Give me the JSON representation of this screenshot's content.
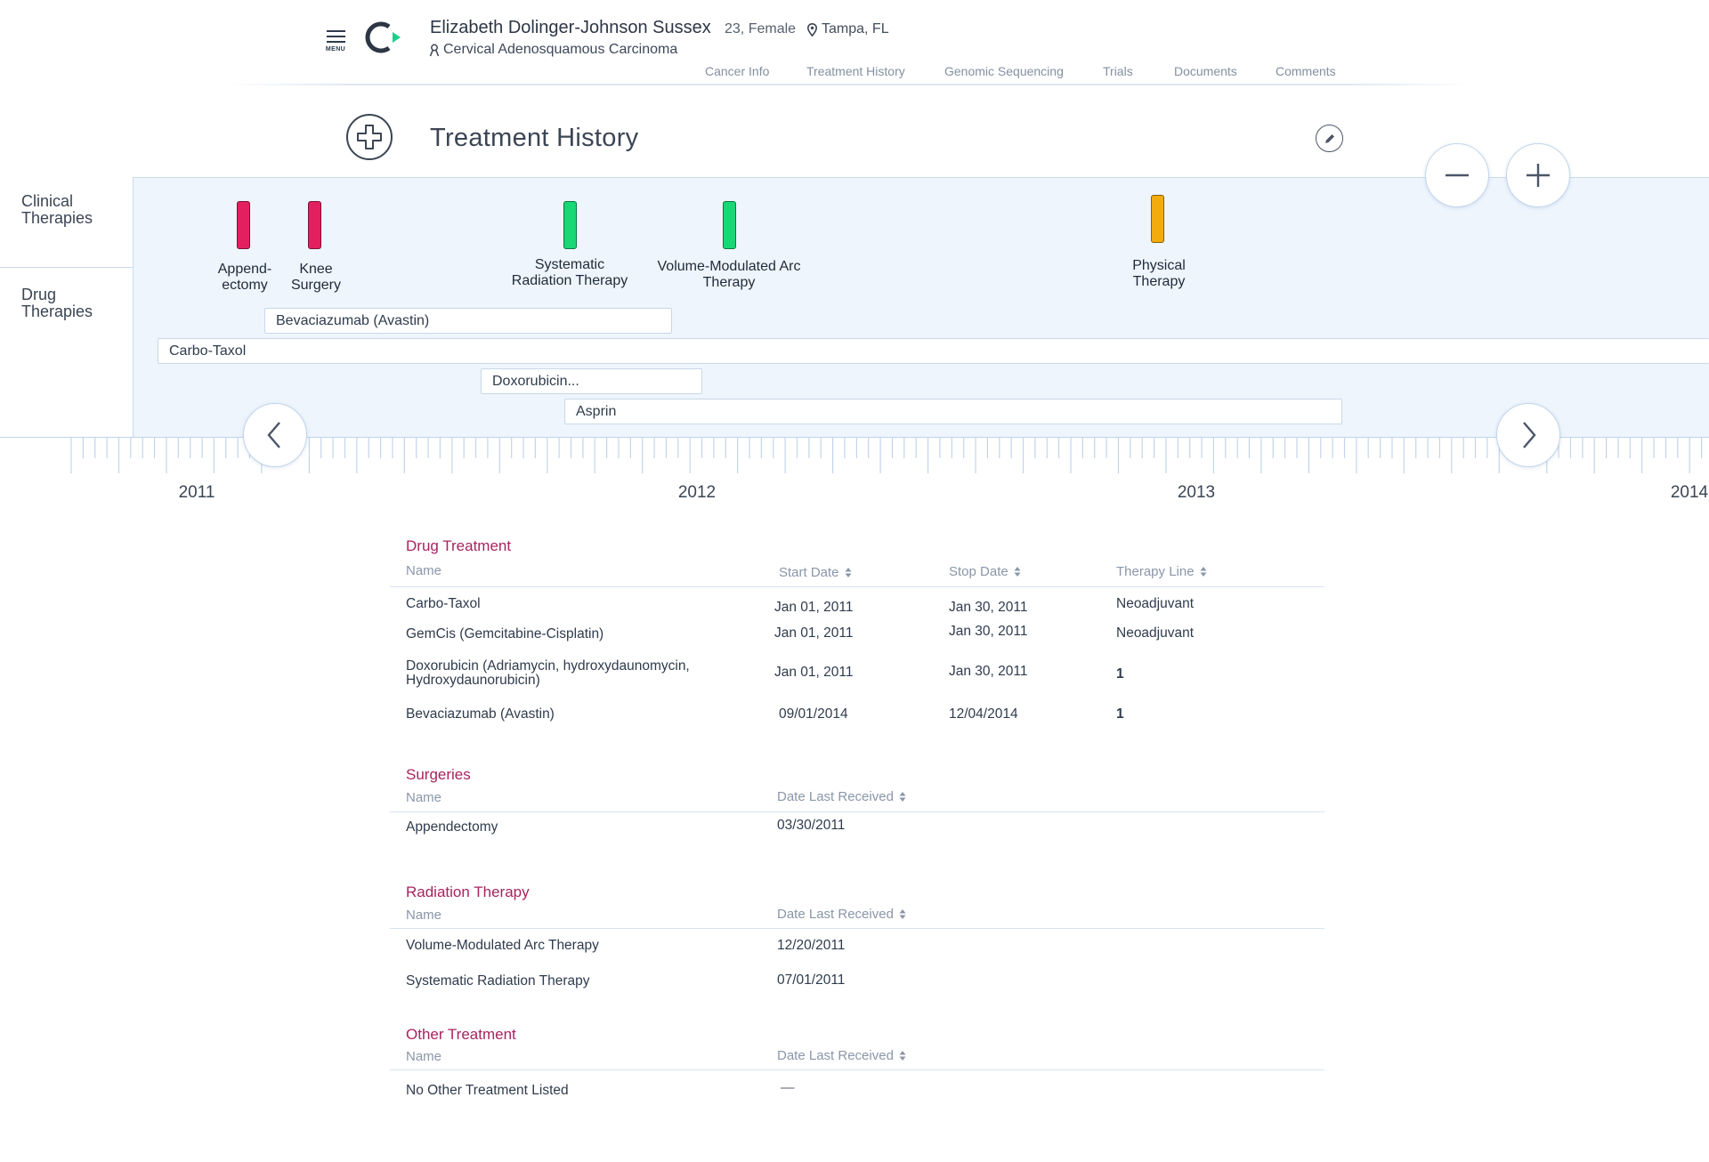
{
  "header": {
    "menu_label": "MENU",
    "patient_name": "Elizabeth Dolinger-Johnson Sussex",
    "age_sex": "23, Female",
    "location": "Tampa, FL",
    "diagnosis": "Cervical Adenosquamous Carcinoma",
    "nav": [
      "Cancer Info",
      "Treatment History",
      "Genomic Sequencing",
      "Trials",
      "Documents",
      "Comments"
    ]
  },
  "page": {
    "title": "Treatment History"
  },
  "timeline": {
    "row_labels": {
      "clinical": "Clinical\nTherapies",
      "drug": "Drug\nTherapies"
    },
    "clinical_events": [
      {
        "label": "Append-\nectomy",
        "color": "#e22060"
      },
      {
        "label": "Knee\nSurgery",
        "color": "#e22060"
      },
      {
        "label": "Systematic\nRadiation Therapy",
        "color": "#17d874"
      },
      {
        "label": "Volume-Modulated Arc\nTherapy",
        "color": "#17d874"
      },
      {
        "label": "Physical\nTherapy",
        "color": "#f2ac0d"
      }
    ],
    "drug_bars": [
      "Bevaciazumab (Avastin)",
      "Carbo-Taxol",
      "Doxorubicin...",
      "Asprin"
    ],
    "years": [
      "2011",
      "2012",
      "2013",
      "2014"
    ]
  },
  "drug_treatment": {
    "title": "Drug Treatment",
    "headers": [
      "Name",
      "Start Date",
      "Stop Date",
      "Therapy Line"
    ],
    "rows": [
      [
        "Carbo-Taxol",
        "Jan 01, 2011",
        "Jan 30, 2011",
        "Neoadjuvant"
      ],
      [
        "GemCis (Gemcitabine-Cisplatin)",
        "Jan 01, 2011",
        "Jan 30, 2011",
        "Neoadjuvant"
      ],
      [
        "Doxorubicin (Adriamycin, hydroxydaunomycin, Hydroxydaunorubicin)",
        "Jan 01, 2011",
        "Jan 30, 2011",
        "1"
      ],
      [
        "Bevaciazumab (Avastin)",
        "09/01/2014",
        "12/04/2014",
        "1"
      ]
    ]
  },
  "surgeries": {
    "title": "Surgeries",
    "headers": [
      "Name",
      "Date Last Received"
    ],
    "rows": [
      [
        "Appendectomy",
        "03/30/2011"
      ]
    ]
  },
  "radiation_therapy": {
    "title": "Radiation Therapy",
    "headers": [
      "Name",
      "Date Last Received"
    ],
    "rows": [
      [
        "Volume-Modulated Arc Therapy",
        "12/20/2011"
      ],
      [
        "Systematic Radiation Therapy",
        "07/01/2011"
      ]
    ]
  },
  "other_treatment": {
    "title": "Other Treatment",
    "headers": [
      "Name",
      "Date Last Received"
    ],
    "rows": [
      [
        "No Other Treatment Listed",
        "—"
      ]
    ]
  }
}
